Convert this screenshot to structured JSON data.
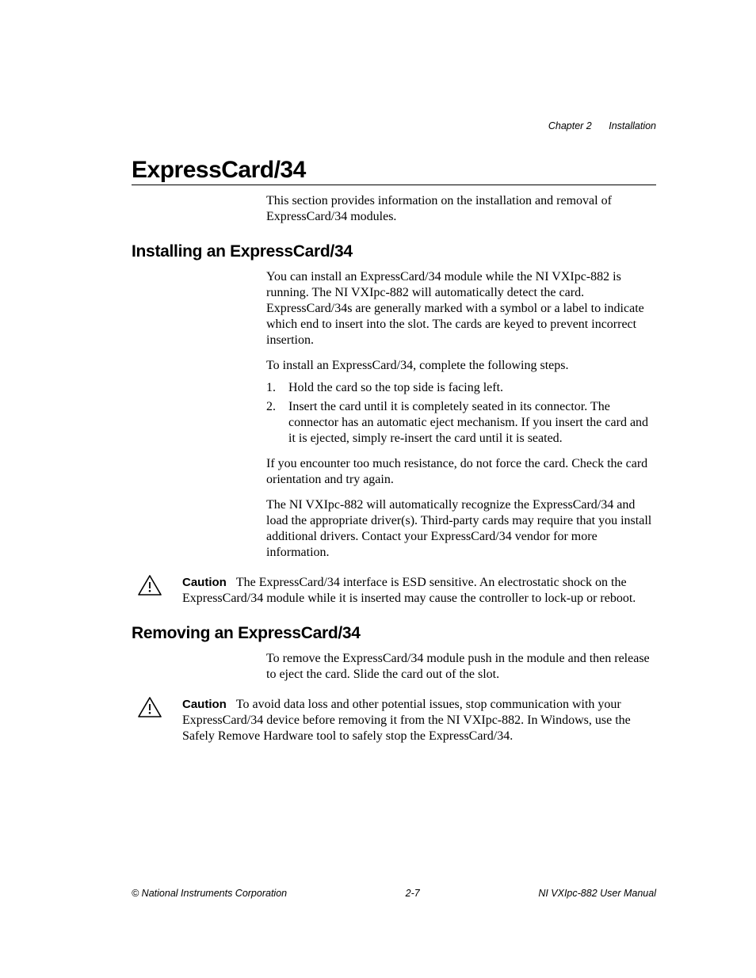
{
  "header": {
    "chapter": "Chapter 2",
    "title": "Installation"
  },
  "h1": "ExpressCard/34",
  "intro": "This section provides information on the installation and removal of ExpressCard/34 modules.",
  "section1": {
    "heading": "Installing an ExpressCard/34",
    "p1": "You can install an ExpressCard/34 module while the NI VXIpc-882 is running. The NI VXIpc-882 will automatically detect the card. ExpressCard/34s are generally marked with a symbol or a label to indicate which end to insert into the slot. The cards are keyed to prevent incorrect insertion.",
    "p2": "To install an ExpressCard/34, complete the following steps.",
    "steps": [
      "Hold the card so the top side is facing left.",
      "Insert the card until it is completely seated in its connector. The connector has an automatic eject mechanism. If you insert the card and it is ejected, simply re-insert the card until it is seated."
    ],
    "p3": "If you encounter too much resistance, do not force the card. Check the card orientation and try again.",
    "p4": "The NI VXIpc-882 will automatically recognize the ExpressCard/34 and load the appropriate driver(s). Third-party cards may require that you install additional drivers. Contact your ExpressCard/34 vendor for more information."
  },
  "caution1": {
    "label": "Caution",
    "text": "The ExpressCard/34 interface is ESD sensitive. An electrostatic shock on the ExpressCard/34 module while it is inserted may cause the controller to lock-up or reboot."
  },
  "section2": {
    "heading": "Removing an ExpressCard/34",
    "p1": "To remove the ExpressCard/34 module push in the module and then release to eject the card. Slide the card out of the slot."
  },
  "caution2": {
    "label": "Caution",
    "text": "To avoid data loss and other potential issues, stop communication with your ExpressCard/34 device before removing it from the NI VXIpc-882. In Windows, use the Safely Remove Hardware tool to safely stop the ExpressCard/34."
  },
  "footer": {
    "left": "© National Instruments Corporation",
    "center": "2-7",
    "right": "NI VXIpc-882 User Manual"
  }
}
